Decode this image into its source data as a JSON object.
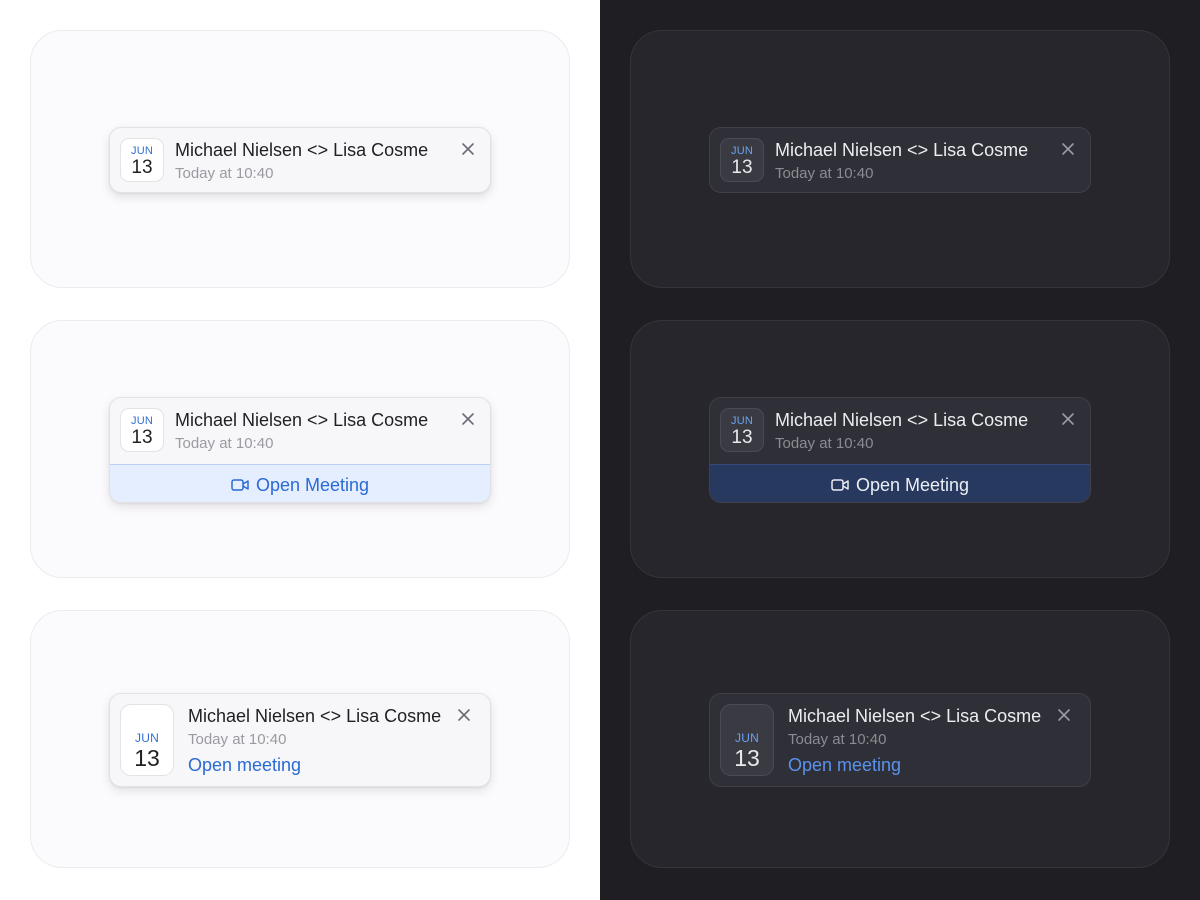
{
  "notification": {
    "month": "JUN",
    "day": "13",
    "title": "Michael Nielsen <> Lisa Cosme",
    "time": "Today at 10:40",
    "open_meeting_button": "Open Meeting",
    "open_meeting_link": "Open meeting"
  },
  "icons": {
    "close": "close-icon",
    "video": "video-camera-icon"
  },
  "themes": {
    "light": {
      "background": "#ffffff",
      "accent": "#2a6ad3",
      "action_bar": "#e4eeff"
    },
    "dark": {
      "background": "#1e1e23",
      "accent": "#5a92ee",
      "action_bar": "#28395f"
    }
  }
}
